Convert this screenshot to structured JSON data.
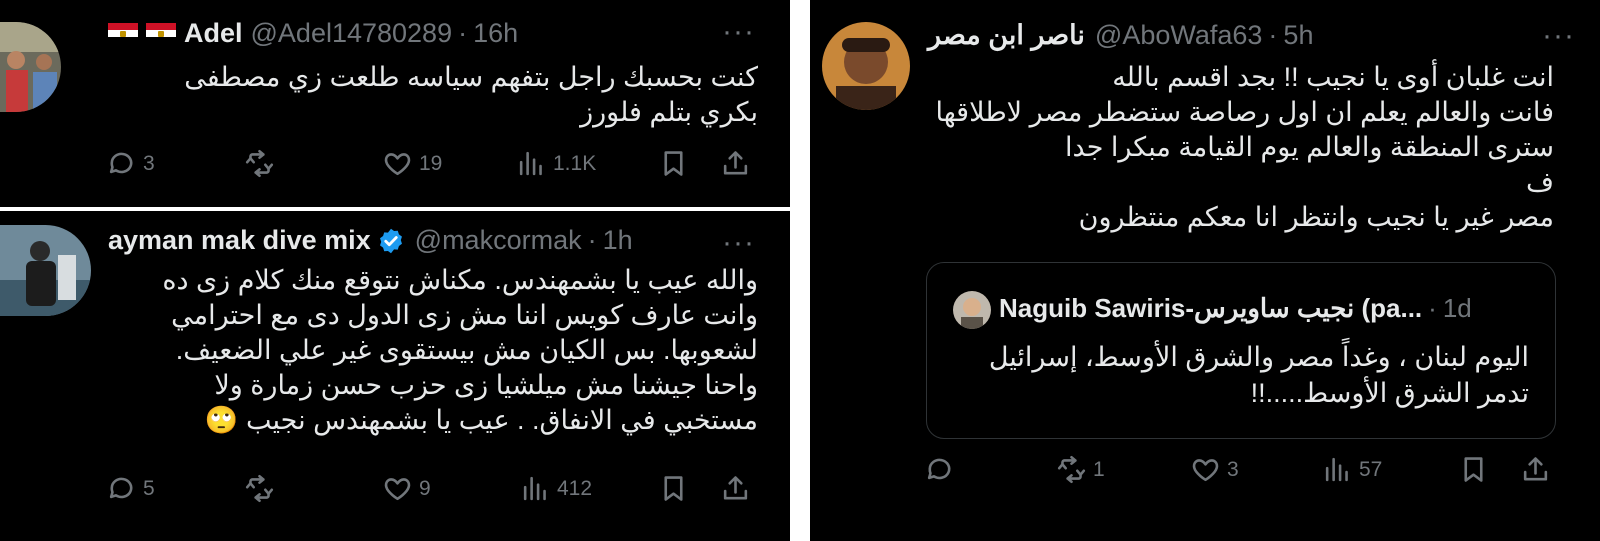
{
  "tweets": [
    {
      "name": "Adel",
      "handle": "@Adel14780289",
      "time": "16h",
      "flags": [
        "egypt-flag",
        "egypt-flag"
      ],
      "lines": [
        "كنت بحسبك راجل بتفهم  سياسه طلعت زي مصطفى",
        "بكري بتلم فلورز"
      ],
      "replies": "3",
      "reposts": "",
      "likes": "19",
      "views": "1.1K"
    },
    {
      "name": "ayman mak dive mix",
      "handle": "@makcormak",
      "time": "1h",
      "verified": true,
      "lines": [
        "والله عيب يا بشمهندس. مكناش نتوقع منك كلام زى ده",
        "وانت عارف كويس اننا مش زى الدول دى مع احترامي",
        "لشعوبها.  بس الكيان مش بيستقوى غير علي الضعيف.",
        "واحنا جيشنا مش ميلشيا زى حزب حسن زمارة ولا",
        "مستخبي في الانفاق.  . عيب يا بشمهندس نجيب 🙄"
      ],
      "replies": "5",
      "reposts": "",
      "likes": "9",
      "views": "412"
    },
    {
      "name": "ناصر ابن مصر",
      "handle": "@AboWafa63",
      "time": "5h",
      "lines": [
        "انت غلبان أوى يا نجيب !! بجد اقسم بالله",
        "فانت والعالم يعلم ان اول رصاصة ستضطر مصر لاطلاقها",
        "سترى المنطقة والعالم يوم القيامة مبكرا جدا",
        "ف",
        "مصر غير يا نجيب وانتظر انا معكم منتظرون"
      ],
      "quote": {
        "name": "Naguib Sawiris-نجيب ساويرس (pa...",
        "time": "1d",
        "lines": [
          "اليوم لبنان ، وغداً مصر  والشرق الأوسط، إسرائيل",
          "تدمر الشرق الأوسط.....!!"
        ]
      },
      "replies": "",
      "reposts": "1",
      "likes": "3",
      "views": "57"
    }
  ],
  "colors": {
    "background": "#000000",
    "text": "#e7e9ea",
    "muted": "#71767b",
    "verified": "#1d9bf0"
  },
  "icons": [
    "reply-icon",
    "repost-icon",
    "like-icon",
    "views-icon",
    "bookmark-icon",
    "share-icon",
    "more-icon",
    "verified-badge-icon"
  ]
}
